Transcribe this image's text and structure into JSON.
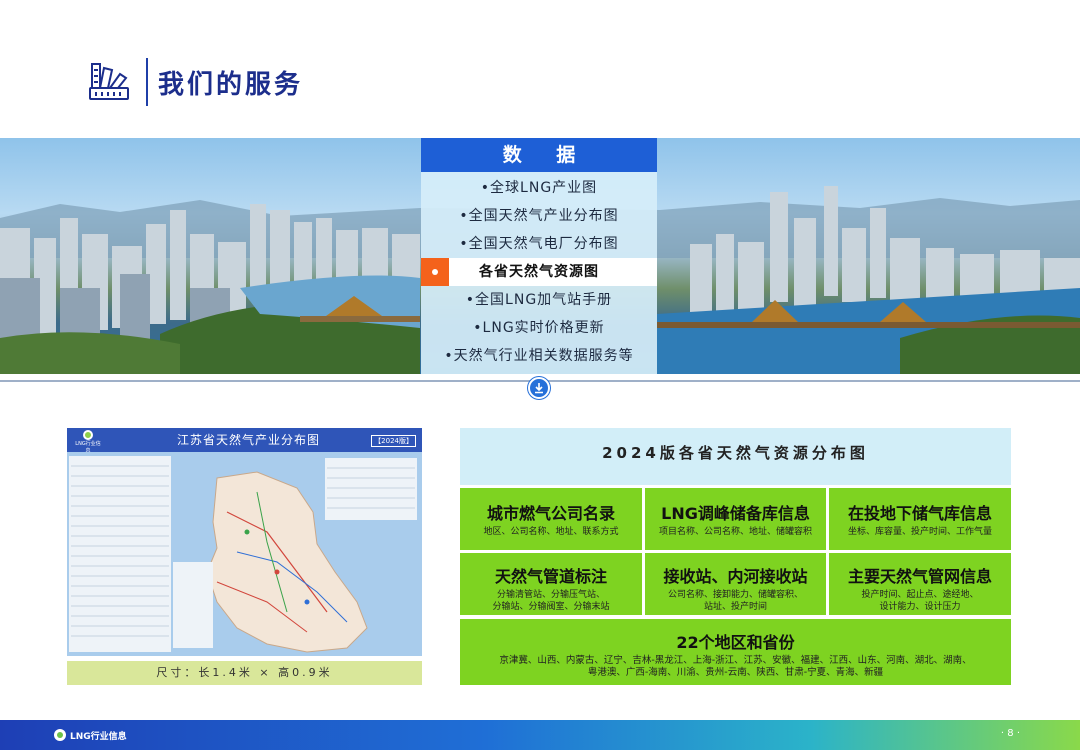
{
  "header": {
    "title": "我们的服务"
  },
  "data_panel": {
    "heading": "数 据",
    "items": [
      {
        "label": "•全球LNG产业图"
      },
      {
        "label": "•全国天然气产业分布图"
      },
      {
        "label": "•全国天然气电厂分布图"
      },
      {
        "label": "各省天然气资源图"
      },
      {
        "label": "•全国LNG加气站手册"
      },
      {
        "label": "•LNG实时价格更新"
      },
      {
        "label": "•天然气行业相关数据服务等"
      }
    ],
    "active_index": 3
  },
  "map_card": {
    "logo_text": "LNG行业信息",
    "title": "江苏省天然气产业分布图",
    "tag": "【2024版】",
    "caption": "尺寸：长1.4米 × 高0.9米"
  },
  "info_card": {
    "title": "2024版各省天然气资源分布图",
    "cells": [
      {
        "title": "城市燃气公司名录",
        "sub": "地区、公司名称、地址、联系方式"
      },
      {
        "title": "LNG调峰储备库信息",
        "sub": "项目名称、公司名称、地址、储罐容积"
      },
      {
        "title": "在投地下储气库信息",
        "sub": "坐标、库容量、投产时间、工作气量"
      },
      {
        "title": "天然气管道标注",
        "sub": "分输清管站、分输压气站、\n分输站、分输阀室、分输末站"
      },
      {
        "title": "接收站、内河接收站",
        "sub": "公司名称、接卸能力、储罐容积、\n站址、投产时间"
      },
      {
        "title": "主要天然气管网信息",
        "sub": "投产时间、起止点、途经地、\n设计能力、设计压力"
      },
      {
        "title": "22个地区和省份",
        "sub": "京津冀、山西、内蒙古、辽宁、吉林-黑龙江、上海-浙江、江苏、安徽、福建、江西、山东、河南、湖北、湖南、\n粤港澳、广西-海南、川渝、贵州-云南、陕西、甘肃-宁夏、青海、新疆"
      }
    ]
  },
  "footer": {
    "brand": "LNG行业信息",
    "page": "· 8 ·"
  },
  "colors": {
    "brand_blue": "#1e5fd6",
    "accent_orange": "#f4621b",
    "cell_green": "#7ed321"
  }
}
